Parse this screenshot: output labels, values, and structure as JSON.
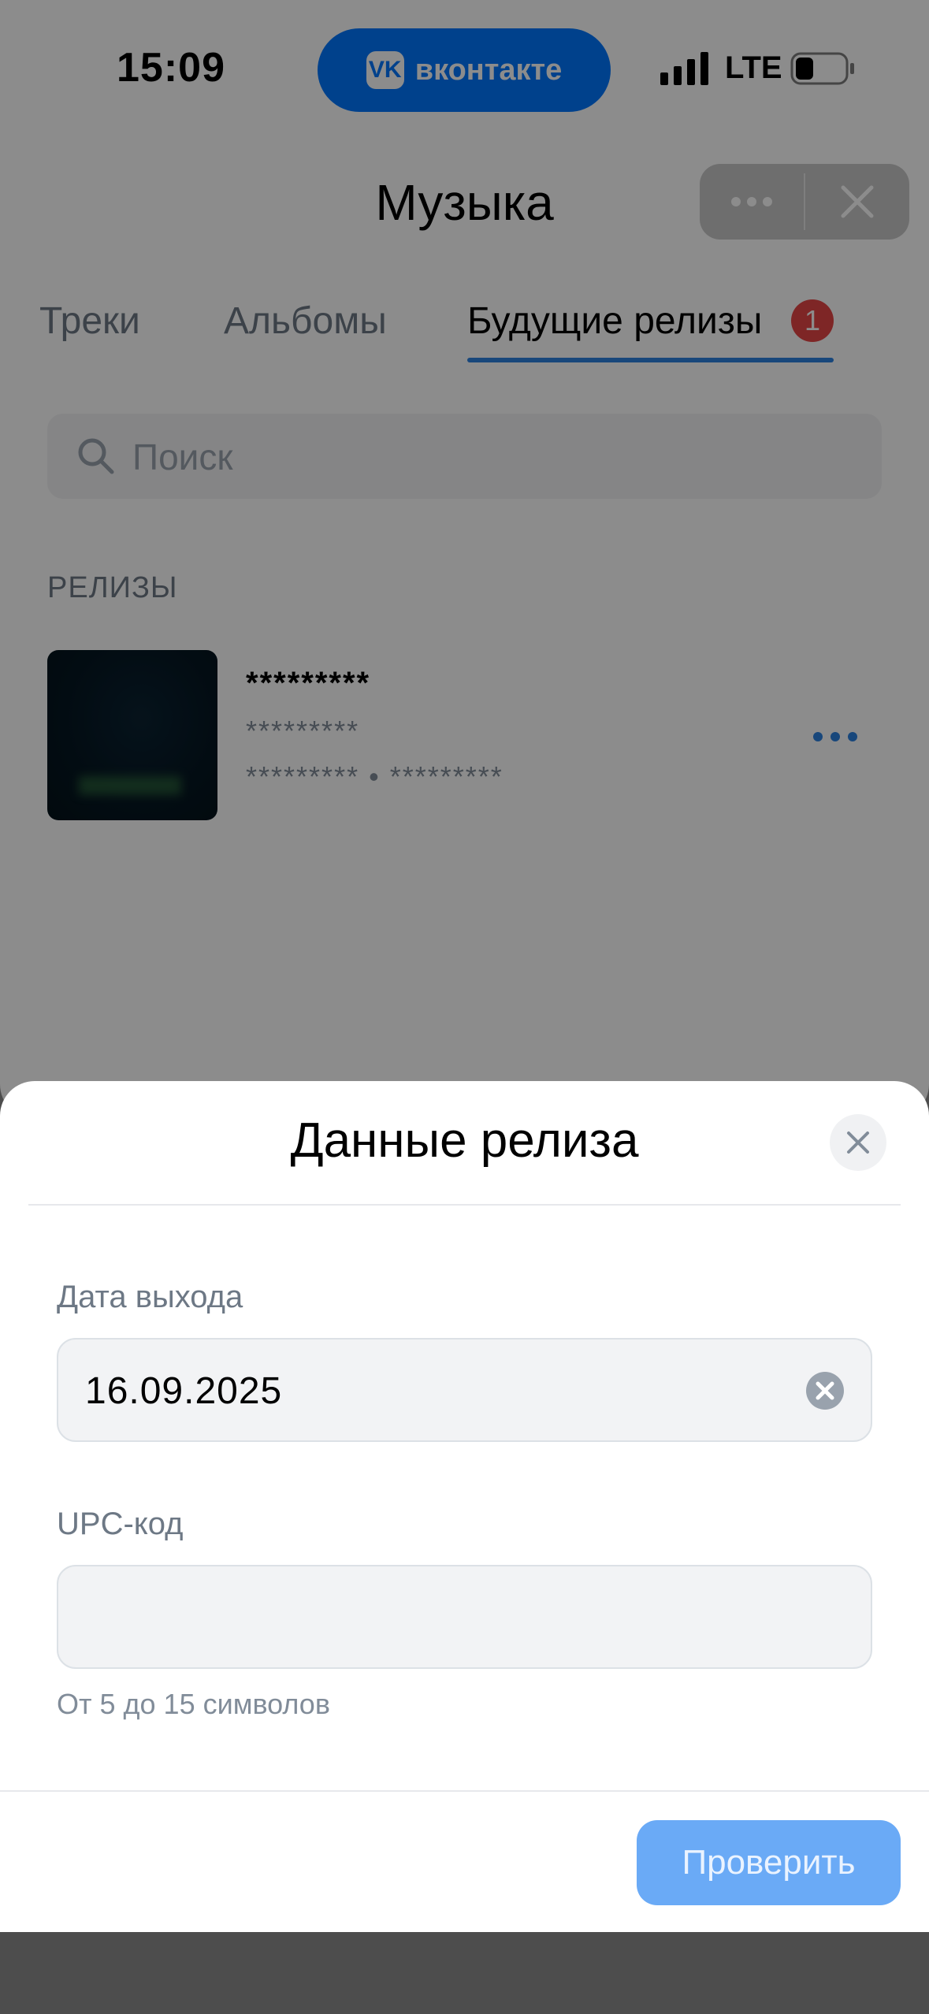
{
  "status_bar": {
    "time": "15:09",
    "app_pill_label": "вконтакте",
    "network": "LTE"
  },
  "header": {
    "title": "Музыка"
  },
  "tabs": [
    {
      "label": "Треки"
    },
    {
      "label": "Альбомы"
    },
    {
      "label": "Будущие релизы",
      "badge": "1",
      "active": true
    }
  ],
  "search": {
    "placeholder": "Поиск"
  },
  "releases_section": {
    "label": "РЕЛИЗЫ",
    "items": [
      {
        "title": "*********",
        "subtitle": "*********",
        "meta": "********* • *********"
      }
    ]
  },
  "modal": {
    "title": "Данные релиза",
    "release_date_label": "Дата выхода",
    "release_date_value": "16.09.2025",
    "upc_label": "UPC-код",
    "upc_value": "",
    "upc_hint": "От 5 до 15 символов",
    "submit_label": "Проверить"
  },
  "colors": {
    "vk_blue": "#0077ff",
    "tab_underline": "#2d81e0",
    "badge": "#e64646",
    "submit_disabled": "#6aaaf6"
  }
}
